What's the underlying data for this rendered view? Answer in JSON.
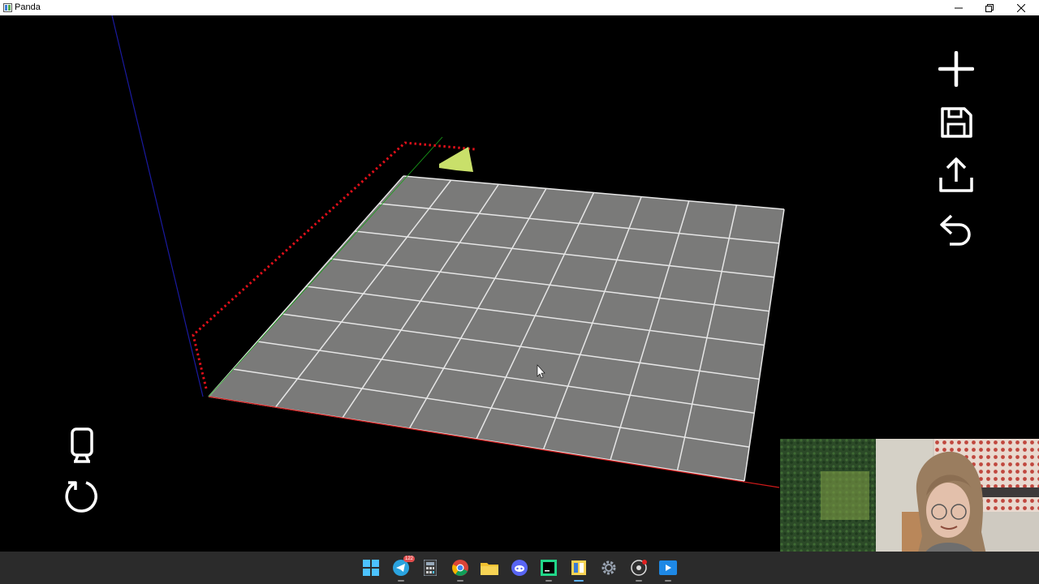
{
  "window": {
    "title": "Panda"
  },
  "toolbar_right": [
    {
      "name": "add-button",
      "icon": "plus-icon"
    },
    {
      "name": "save-button",
      "icon": "save-icon"
    },
    {
      "name": "export-button",
      "icon": "upload-icon"
    },
    {
      "name": "undo-button",
      "icon": "undo-icon"
    }
  ],
  "toolbar_left": [
    {
      "name": "device-button",
      "icon": "device-icon"
    },
    {
      "name": "reset-button",
      "icon": "rotate-icon"
    }
  ],
  "taskbar": {
    "apps": [
      {
        "name": "start",
        "icon": "windows-icon"
      },
      {
        "name": "telegram",
        "icon": "telegram-icon",
        "badge": "122"
      },
      {
        "name": "calculator",
        "icon": "calculator-icon"
      },
      {
        "name": "chrome",
        "icon": "chrome-icon"
      },
      {
        "name": "file-explorer",
        "icon": "folder-icon"
      },
      {
        "name": "discord",
        "icon": "discord-icon"
      },
      {
        "name": "pycharm",
        "icon": "pycharm-icon"
      },
      {
        "name": "panda-app",
        "icon": "panda-icon"
      },
      {
        "name": "settings",
        "icon": "gear-icon"
      },
      {
        "name": "obs",
        "icon": "record-icon"
      },
      {
        "name": "media-player",
        "icon": "media-icon"
      }
    ]
  },
  "colors": {
    "grid_fill": "#7a7a79",
    "grid_lines": "#e6e6e6",
    "axis_x": "#d11a1a",
    "axis_y": "#1aa31a",
    "axis_z": "#1a1aa0",
    "camera_marker": "#c9e06a"
  }
}
